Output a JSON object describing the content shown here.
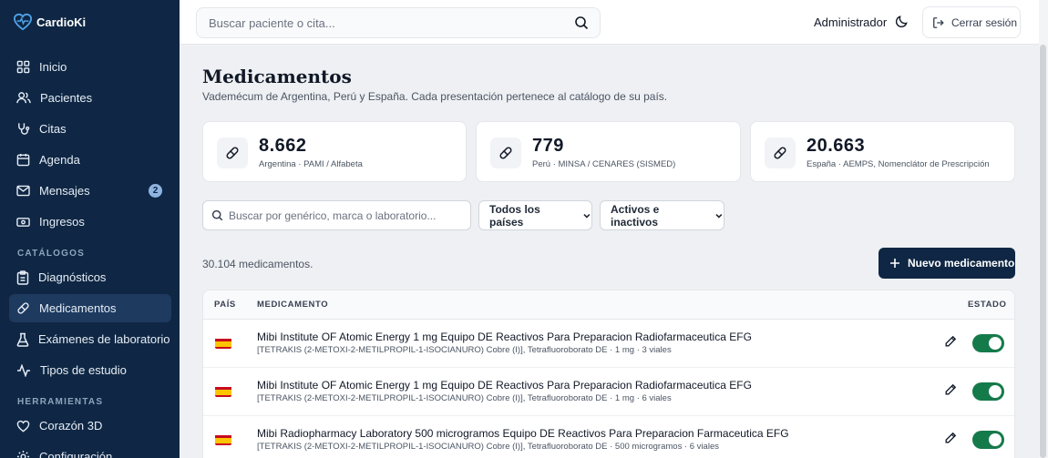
{
  "app": {
    "name": "CardioKi"
  },
  "sidebar": {
    "items": [
      {
        "label": "Inicio",
        "icon": "grid-icon"
      },
      {
        "label": "Pacientes",
        "icon": "users-icon"
      },
      {
        "label": "Citas",
        "icon": "stethoscope-icon"
      },
      {
        "label": "Agenda",
        "icon": "calendar-icon"
      },
      {
        "label": "Mensajes",
        "icon": "mail-icon",
        "badge": "2"
      },
      {
        "label": "Ingresos",
        "icon": "banknote-icon"
      }
    ],
    "catalogs_label": "CATÁLOGOS",
    "catalogs": [
      {
        "label": "Diagnósticos",
        "icon": "clipboard-icon"
      },
      {
        "label": "Medicamentos",
        "icon": "pill-icon",
        "active": true
      },
      {
        "label": "Exámenes de laboratorio",
        "icon": "flask-icon"
      },
      {
        "label": "Tipos de estudio",
        "icon": "activity-icon"
      }
    ],
    "tools_label": "HERRAMIENTAS",
    "tools": [
      {
        "label": "Corazón 3D",
        "icon": "heart-icon"
      },
      {
        "label": "Configuración",
        "icon": "gear-icon"
      }
    ]
  },
  "topbar": {
    "search_placeholder": "Buscar paciente o cita...",
    "user": "Administrador",
    "logout": "Cerrar sesión"
  },
  "page": {
    "title": "Medicamentos",
    "subtitle": "Vademécum de Argentina, Perú y España. Cada presentación pertenece al catálogo de su país."
  },
  "stats": [
    {
      "value": "8.662",
      "label": "Argentina · PAMI / Alfabeta"
    },
    {
      "value": "779",
      "label": "Perú · MINSA / CENARES (SISMED)"
    },
    {
      "value": "20.663",
      "label": "España · AEMPS, Nomenclátor de Prescripción"
    }
  ],
  "filters": {
    "search_placeholder": "Buscar por genérico, marca o laboratorio...",
    "country": "Todos los países",
    "status": "Activos e inactivos"
  },
  "results": {
    "count": "30.104 medicamentos.",
    "new_button": "Nuevo medicamento"
  },
  "table": {
    "columns": [
      "PAÍS",
      "MEDICAMENTO",
      "ESTADO"
    ],
    "rows": [
      {
        "country": "España",
        "title": "Mibi Institute OF Atomic Energy 1 mg Equipo DE Reactivos Para Preparacion Radiofarmaceutica EFG",
        "detail": "[TETRAKIS (2-METOXI-2-METILPROPIL-1-ISOCIANURO) Cobre (I)], Tetrafluoroborato DE · 1 mg · 3 viales",
        "active": true
      },
      {
        "country": "España",
        "title": "Mibi Institute OF Atomic Energy 1 mg Equipo DE Reactivos Para Preparacion Radiofarmaceutica EFG",
        "detail": "[TETRAKIS (2-METOXI-2-METILPROPIL-1-ISOCIANURO) Cobre (I)], Tetrafluoroborato DE · 1 mg · 6 viales",
        "active": true
      },
      {
        "country": "España",
        "title": "Mibi Radiopharmacy Laboratory 500 microgramos Equipo DE Reactivos Para Preparacion Farmaceutica EFG",
        "detail": "[TETRAKIS (2-METOXI-2-METILPROPIL-1-ISOCIANURO) Cobre (I)], Tetrafluoroborato DE · 500 microgramos · 6 viales",
        "active": true
      }
    ]
  },
  "colors": {
    "sidebar": "#0f2744",
    "primary": "#0f2744",
    "toggle_on": "#157a4a"
  }
}
